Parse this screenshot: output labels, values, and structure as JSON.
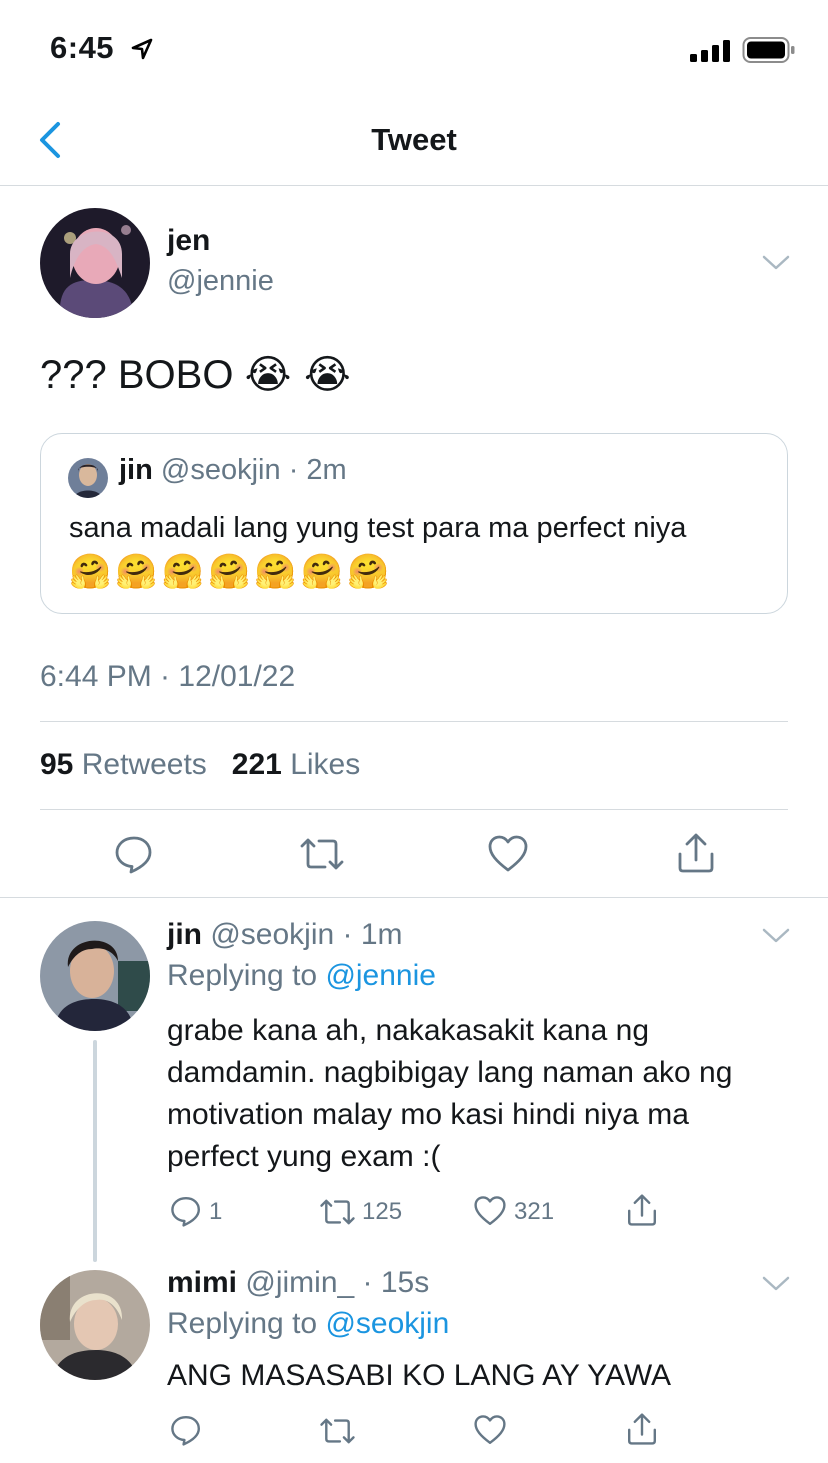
{
  "status_bar": {
    "time": "6:45"
  },
  "nav": {
    "title": "Tweet"
  },
  "tweet": {
    "name": "jen",
    "handle": "@jennie",
    "text": "??? BOBO",
    "text_emoji": "😭 😭",
    "timestamp": "6:44 PM · 12/01/22",
    "stats": {
      "retweets": "95",
      "retweets_label": "Retweets",
      "likes": "221",
      "likes_label": "Likes"
    }
  },
  "quote": {
    "name": "jin",
    "handle": "@seokjin",
    "sep": "·",
    "time": "2m",
    "text": "sana madali lang yung test para ma perfect niya",
    "emoji": "🤗🤗🤗🤗🤗🤗🤗"
  },
  "replies": [
    {
      "name": "jin",
      "handle": "@seokjin",
      "sep": "·",
      "time": "1m",
      "replying_label": "Replying to",
      "replying_to": "@jennie",
      "text_lines": [
        "grabe kana ah, nakakasakit kana ng",
        "damdamin. nagbibigay lang naman ako ng",
        "motivation malay mo kasi hindi niya ma",
        "perfect yung exam :("
      ],
      "replies": "1",
      "retweets": "125",
      "likes": "321"
    },
    {
      "name": "mimi",
      "handle": "@jimin_",
      "sep": "·",
      "time": "15s",
      "replying_label": "Replying to",
      "replying_to": "@seokjin",
      "text": "ANG MASASABI KO LANG AY YAWA"
    }
  ],
  "colors": {
    "accent": "#1b95e0",
    "muted": "#657786",
    "divider": "#d6dbdf",
    "text": "#14171a"
  }
}
